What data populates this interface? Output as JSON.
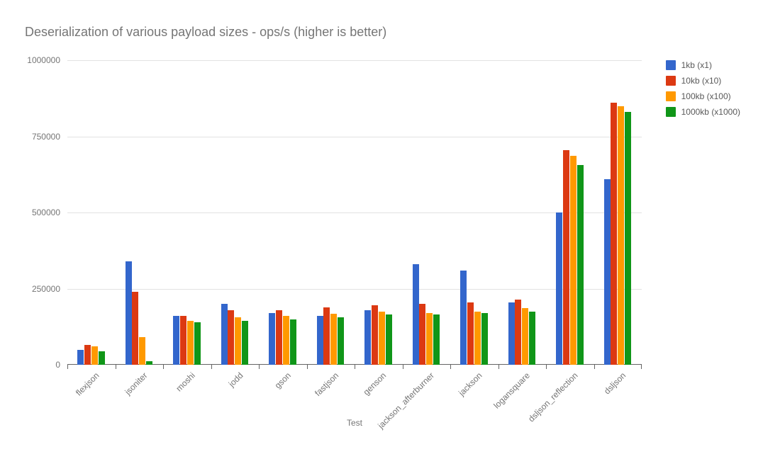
{
  "chart_data": {
    "type": "bar",
    "title": "Deserialization of various payload sizes  - ops/s (higher is better)",
    "xlabel": "Test",
    "ylabel": "",
    "ylim": [
      0,
      1000000
    ],
    "yticks": [
      0,
      250000,
      500000,
      750000,
      1000000
    ],
    "categories": [
      "flexjson",
      "jsoniter",
      "moshi",
      "jodd",
      "gson",
      "fastjson",
      "genson",
      "jackson_afterburner",
      "jackson",
      "logansquare",
      "dsljson_reflection",
      "dsljson"
    ],
    "series": [
      {
        "name": "1kb (x1)",
        "color": "#3366cc",
        "values": [
          50000,
          340000,
          160000,
          200000,
          170000,
          160000,
          180000,
          330000,
          310000,
          205000,
          500000,
          610000
        ]
      },
      {
        "name": "10kb (x10)",
        "color": "#dc3912",
        "values": [
          65000,
          240000,
          160000,
          180000,
          178000,
          188000,
          195000,
          200000,
          205000,
          215000,
          705000,
          860000
        ]
      },
      {
        "name": "100kb (x100)",
        "color": "#ff9900",
        "values": [
          60000,
          90000,
          145000,
          155000,
          160000,
          168000,
          175000,
          170000,
          175000,
          185000,
          685000,
          850000
        ]
      },
      {
        "name": "1000kb (x1000)",
        "color": "#109618",
        "values": [
          45000,
          12000,
          140000,
          145000,
          150000,
          155000,
          165000,
          165000,
          170000,
          175000,
          655000,
          830000
        ]
      }
    ],
    "legend_position": "right"
  }
}
